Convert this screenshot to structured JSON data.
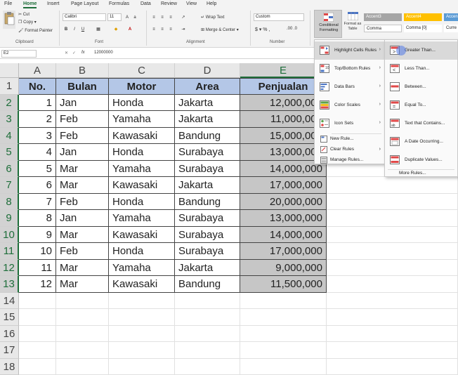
{
  "menu_tabs": [
    "File",
    "Home",
    "Insert",
    "Page Layout",
    "Formulas",
    "Data",
    "Review",
    "View",
    "Help"
  ],
  "ribbon": {
    "clipboard": {
      "cut": "Cut",
      "copy": "Copy",
      "format_painter": "Format Painter",
      "label": "Clipboard"
    },
    "font": {
      "name": "Calibri",
      "size": "11",
      "label": "Font"
    },
    "alignment": {
      "wrap": "Wrap Text",
      "merge": "Merge & Center",
      "label": "Alignment"
    },
    "number": {
      "format": "Custom",
      "label": "Number"
    },
    "styles": {
      "conditional": "Conditional Formatting",
      "format_table": "Format as Table",
      "boxes": [
        {
          "text": "Accent3",
          "bg": "#a5a5a5",
          "fg": "#ffffff"
        },
        {
          "text": "Accent4",
          "bg": "#ffc000",
          "fg": "#ffffff"
        },
        {
          "text": "Accen",
          "bg": "#5b9bd5",
          "fg": "#ffffff"
        },
        {
          "text": "Comma",
          "bg": "#ffffff",
          "fg": "#222222"
        },
        {
          "text": "Comma [0]",
          "bg": "#ffffff",
          "fg": "#222222"
        },
        {
          "text": "Curre",
          "bg": "#ffffff",
          "fg": "#222222"
        }
      ]
    }
  },
  "formula_bar": {
    "name_box": "E2",
    "fx": "fx",
    "value": "12000000"
  },
  "columns": [
    "A",
    "B",
    "C",
    "D",
    "E"
  ],
  "rows": [
    "1",
    "2",
    "3",
    "4",
    "5",
    "6",
    "7",
    "8",
    "9",
    "10",
    "11",
    "12",
    "13",
    "14",
    "15",
    "16",
    "17",
    "18"
  ],
  "headers": [
    "No.",
    "Bulan",
    "Motor",
    "Area",
    "Penjualan"
  ],
  "data": [
    [
      "1",
      "Jan",
      "Honda",
      "Jakarta",
      "12,000,000"
    ],
    [
      "2",
      "Feb",
      "Yamaha",
      "Jakarta",
      "11,000,000"
    ],
    [
      "3",
      "Feb",
      "Kawasaki",
      "Bandung",
      "15,000,000"
    ],
    [
      "4",
      "Jan",
      "Honda",
      "Surabaya",
      "13,000,000"
    ],
    [
      "5",
      "Mar",
      "Yamaha",
      "Surabaya",
      "14,000,000"
    ],
    [
      "6",
      "Mar",
      "Kawasaki",
      "Jakarta",
      "17,000,000"
    ],
    [
      "7",
      "Feb",
      "Honda",
      "Bandung",
      "20,000,000"
    ],
    [
      "8",
      "Jan",
      "Yamaha",
      "Surabaya",
      "13,000,000"
    ],
    [
      "9",
      "Mar",
      "Kawasaki",
      "Surabaya",
      "14,000,000"
    ],
    [
      "10",
      "Feb",
      "Honda",
      "Surabaya",
      "17,000,000"
    ],
    [
      "11",
      "Mar",
      "Yamaha",
      "Jakarta",
      "9,000,000"
    ],
    [
      "12",
      "Mar",
      "Kawasaki",
      "Bandung",
      "11,500,000"
    ]
  ],
  "cf_menu": [
    {
      "label": "Highlight Cells Rules",
      "icon": "highlight-cells-icon"
    },
    {
      "label": "Top/Bottom Rules",
      "icon": "top-bottom-icon"
    },
    {
      "label": "Data Bars",
      "icon": "data-bars-icon"
    },
    {
      "label": "Color Scales",
      "icon": "color-scales-icon"
    },
    {
      "label": "Icon Sets",
      "icon": "icon-sets-icon"
    }
  ],
  "cf_small": [
    {
      "label": "New Rule...",
      "icon": "new-rule-icon"
    },
    {
      "label": "Clear Rules",
      "icon": "clear-rules-icon"
    },
    {
      "label": "Manage Rules...",
      "icon": "manage-rules-icon"
    }
  ],
  "sub_menu": [
    {
      "label": "Greater Than...",
      "icon": "greater-than-icon"
    },
    {
      "label": "Less Than...",
      "icon": "less-than-icon"
    },
    {
      "label": "Between...",
      "icon": "between-icon"
    },
    {
      "label": "Equal To...",
      "icon": "equal-to-icon"
    },
    {
      "label": "Text that Contains...",
      "icon": "text-contains-icon"
    },
    {
      "label": "A Date Occurring...",
      "icon": "date-occurring-icon"
    },
    {
      "label": "Duplicate Values...",
      "icon": "duplicate-values-icon"
    }
  ],
  "sub_more": "More Rules..."
}
